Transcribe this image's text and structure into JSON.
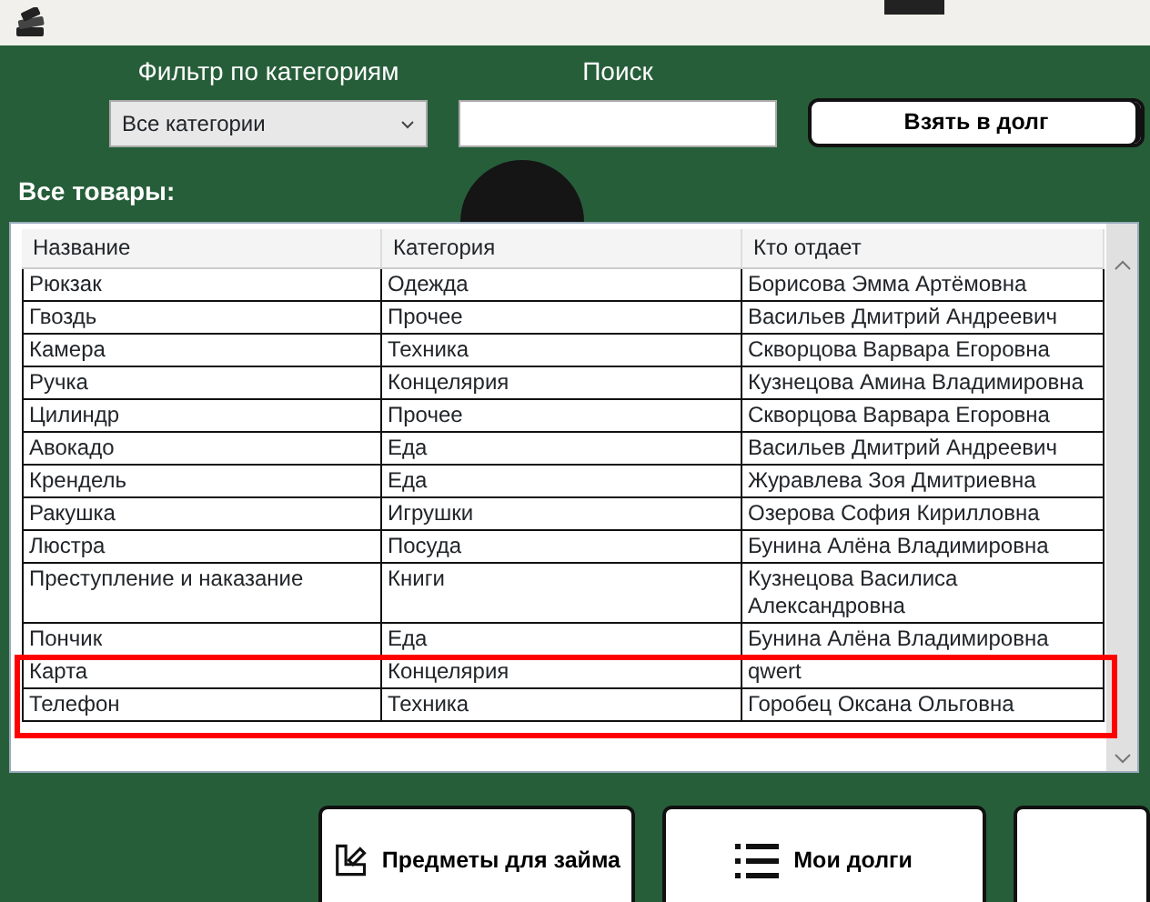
{
  "filter": {
    "label": "Фильтр по категориям",
    "value": "Все категории"
  },
  "search": {
    "label": "Поиск"
  },
  "borrow_button": "Взять в долг",
  "section_title": "Все товары:",
  "table": {
    "columns": [
      "Название",
      "Категория",
      "Кто отдает"
    ],
    "rows": [
      [
        "Рюкзак",
        "Одежда",
        "Борисова Эмма Артёмовна"
      ],
      [
        "Гвоздь",
        "Прочее",
        "Васильев Дмитрий Андреевич"
      ],
      [
        "Камера",
        "Техника",
        "Скворцова Варвара Егоровна"
      ],
      [
        "Ручка",
        "Концелярия",
        "Кузнецова Амина Владимировна"
      ],
      [
        "Цилиндр",
        "Прочее",
        "Скворцова Варвара Егоровна"
      ],
      [
        "Авокадо",
        "Еда",
        "Васильев Дмитрий Андреевич"
      ],
      [
        "Крендель",
        "Еда",
        "Журавлева Зоя Дмитриевна"
      ],
      [
        "Ракушка",
        "Игрушки",
        "Озерова София Кирилловна"
      ],
      [
        "Люстра",
        "Посуда",
        "Бунина Алёна Владимировна"
      ],
      [
        "Преступление и наказание",
        "Книги",
        "Кузнецова Василиса Александровна"
      ],
      [
        "Пончик",
        "Еда",
        "Бунина Алёна Владимировна"
      ],
      [
        "Карта",
        "Концелярия",
        "qwert"
      ],
      [
        "Телефон",
        "Техника",
        "Горобец Оксана Ольговна"
      ]
    ]
  },
  "annotation": {
    "shown": true
  },
  "nav_buttons": [
    {
      "kind": "edit",
      "label": "Предметы для займа"
    },
    {
      "kind": "list",
      "label": "Мои долги"
    },
    {
      "kind": "blank"
    }
  ]
}
